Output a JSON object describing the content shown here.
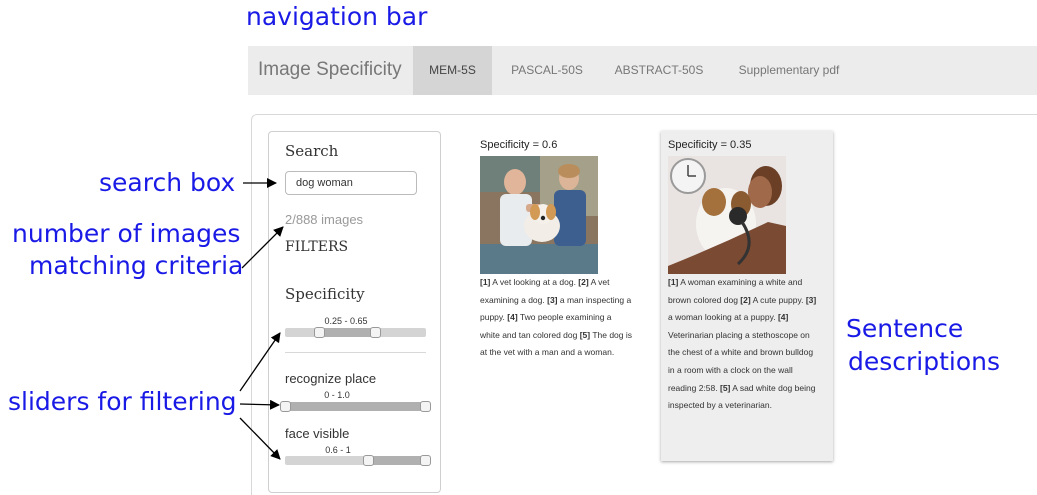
{
  "annotations": {
    "navigation_bar": "navigation bar",
    "search_box": "search box",
    "number_line1": "number of images",
    "number_line2": "matching criteria",
    "sliders": "sliders for filtering",
    "sentence_line1": "Sentence",
    "sentence_line2": "descriptions"
  },
  "nav": {
    "brand": "Image Specificity",
    "links": [
      "MEM-5S",
      "PASCAL-50S",
      "ABSTRACT-50S",
      "Supplementary pdf"
    ],
    "active": "MEM-5S"
  },
  "sidebar": {
    "search_heading": "Search",
    "search_value": "dog woman",
    "count": "2/888 images",
    "filters_heading": "FILTERS",
    "specificity_heading": "Specificity",
    "specificity_range": "0.25 - 0.65",
    "specificity_low": 0.25,
    "specificity_high": 0.65,
    "recognize_label": "recognize place",
    "recognize_range": "0 - 1.0",
    "recognize_low": 0.0,
    "recognize_high": 1.0,
    "face_label": "face visible",
    "face_range": "0.6 - 1",
    "face_low": 0.6,
    "face_high": 1.0
  },
  "results": [
    {
      "specificity": "Specificity = 0.6",
      "image": "vet-with-dog-photo",
      "sentences": [
        {
          "n": "[1]",
          "t": " A vet looking at a dog. "
        },
        {
          "n": "[2]",
          "t": " A vet examining a dog. "
        },
        {
          "n": "[3]",
          "t": " a man inspecting a puppy. "
        },
        {
          "n": "[4]",
          "t": " Two people examining a white and tan colored dog "
        },
        {
          "n": "[5]",
          "t": " The dog is at the vet with a man and a woman."
        }
      ]
    },
    {
      "specificity": "Specificity = 0.35",
      "image": "woman-with-bulldog-photo",
      "sentences": [
        {
          "n": "[1]",
          "t": " A woman examining a white and brown colored dog "
        },
        {
          "n": "[2]",
          "t": " A cute puppy. "
        },
        {
          "n": "[3]",
          "t": " a woman looking at a puppy. "
        },
        {
          "n": "[4]",
          "t": " Veterinarian placing a stethoscope on the chest of a white and brown bulldog in a room with a clock on the wall reading 2:58. "
        },
        {
          "n": "[5]",
          "t": " A sad white dog being inspected by a veterinarian."
        }
      ]
    }
  ]
}
